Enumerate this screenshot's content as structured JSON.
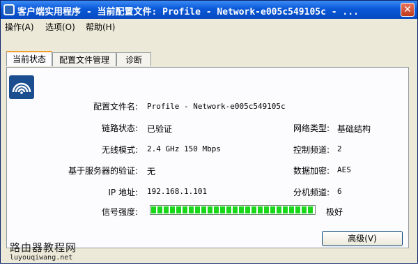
{
  "window": {
    "title": "客户端实用程序 - 当前配置文件: Profile - Network-e005c549105c - ...",
    "close_glyph": "✕"
  },
  "menu": [
    {
      "label": "操作(A)"
    },
    {
      "label": "选项(O)"
    },
    {
      "label": "帮助(H)"
    }
  ],
  "tabs": [
    {
      "label": "当前状态",
      "active": true
    },
    {
      "label": "配置文件管理",
      "active": false
    },
    {
      "label": "诊断",
      "active": false
    }
  ],
  "status": {
    "profile_name_label": "配置文件名:",
    "profile_name_value": "Profile - Network-e005c549105c",
    "link_status_label": "链路状态:",
    "link_status_value": "已验证",
    "network_type_label": "网络类型:",
    "network_type_value": "基础结构",
    "wireless_mode_label": "无线模式:",
    "wireless_mode_value": "2.4 GHz 150 Mbps",
    "control_channel_label": "控制频道:",
    "control_channel_value": "2",
    "server_auth_label": "基于服务器的验证:",
    "server_auth_value": "无",
    "data_encryption_label": "数据加密:",
    "data_encryption_value": "AES",
    "ip_address_label": "IP 地址:",
    "ip_address_value": "192.168.1.101",
    "sub_channel_label": "分机频道:",
    "sub_channel_value": "6",
    "signal_strength_label": "信号强度:",
    "signal_strength_level": 1.0,
    "signal_strength_text": "极好"
  },
  "buttons": {
    "advanced_label": "高级(V)"
  },
  "watermark": {
    "site_name": "路由器教程网",
    "site_url": "luyouqiwang.net"
  },
  "colors": {
    "titlebar": "#0a58d8",
    "signal_fill": "#19d819",
    "active_tab_accent": "#f0a030"
  },
  "icons": {
    "app_icon": "wireless-icon",
    "status_icon": "wifi-signal-icon",
    "close": "close-icon"
  }
}
